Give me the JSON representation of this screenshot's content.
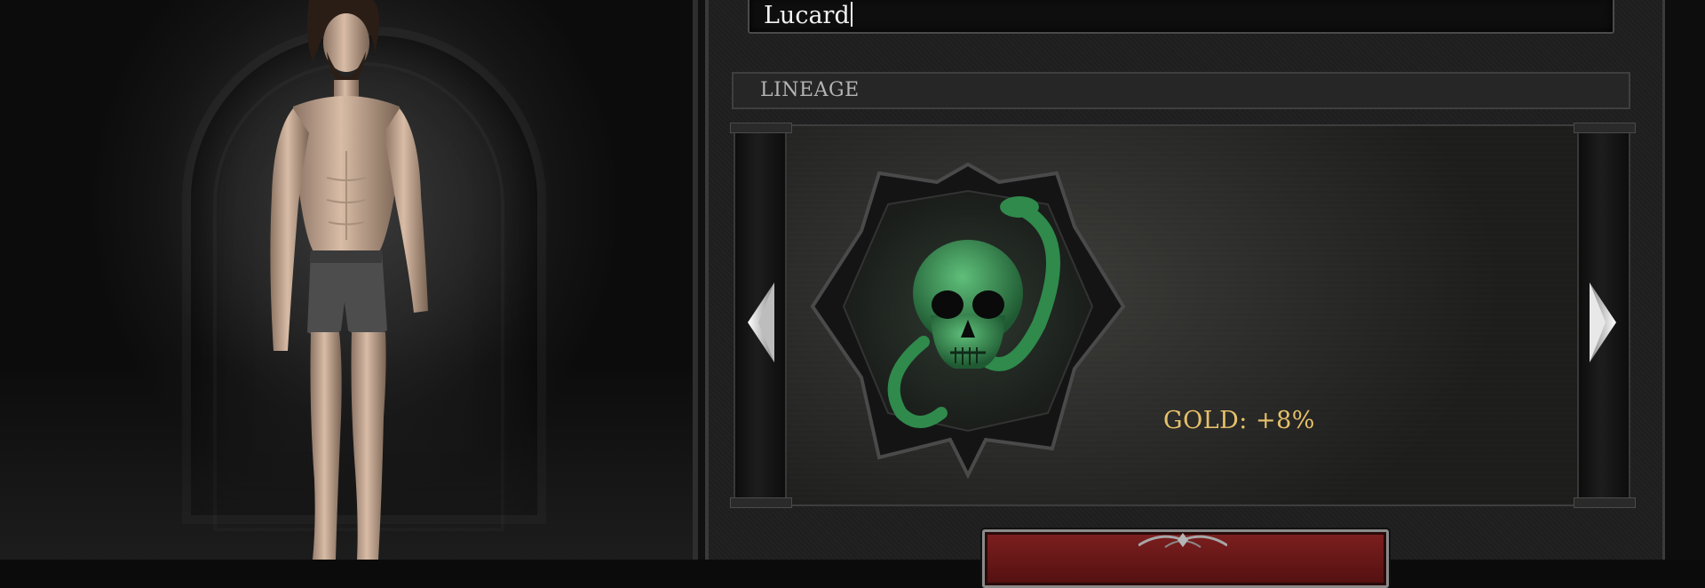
{
  "character": {
    "name_value": "Lucard"
  },
  "lineage": {
    "header_label": "LINEAGE",
    "selected_emblem": "green-skull-serpent-emblem",
    "bonus_text": "GOLD: +8%"
  },
  "navigation": {
    "prev_icon": "left-arrow-icon",
    "next_icon": "right-arrow-icon"
  },
  "colors": {
    "bonus_gold": "#e6c16a",
    "emblem_green": "#3f9a5a",
    "button_red": "#7d1f1f"
  }
}
